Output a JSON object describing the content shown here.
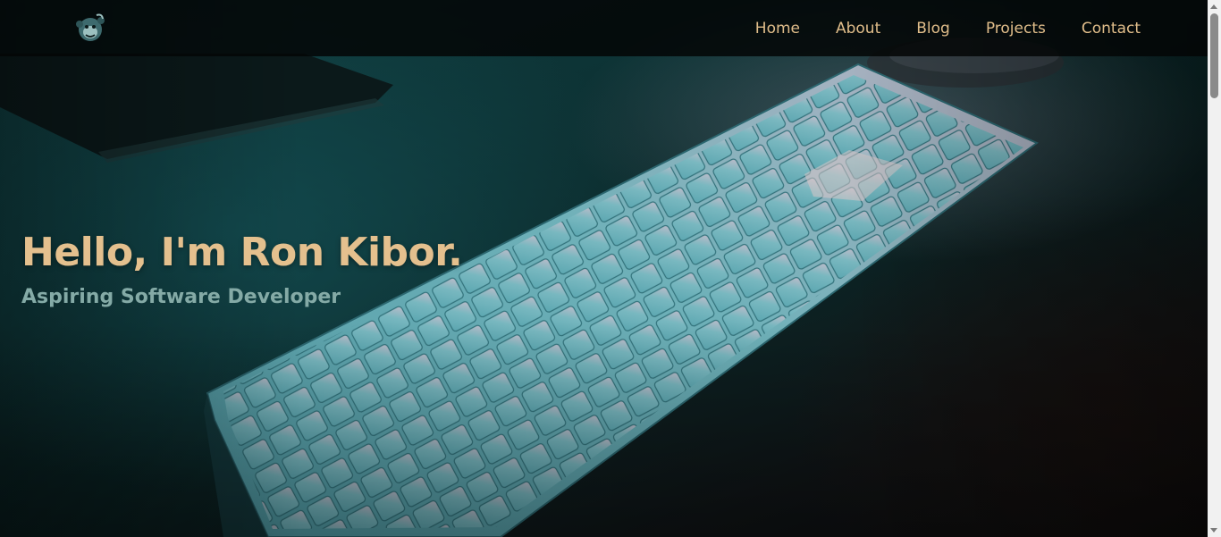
{
  "nav": {
    "logo_icon": "monkey-logo-icon",
    "links": [
      {
        "label": "Home"
      },
      {
        "label": "About"
      },
      {
        "label": "Blog"
      },
      {
        "label": "Projects"
      },
      {
        "label": "Contact"
      }
    ]
  },
  "hero": {
    "title": "Hello, I'm Ron Kibor.",
    "subtitle": "Aspiring Software Developer",
    "background_image": "keyboard-on-desk-photo"
  },
  "colors": {
    "accent": "#e4c08e",
    "subtitle": "#84aaa6",
    "navbar_bg": "#050707"
  },
  "scrollbar": {
    "icons": [
      "scroll-up-arrow-icon",
      "scroll-down-arrow-icon"
    ]
  }
}
